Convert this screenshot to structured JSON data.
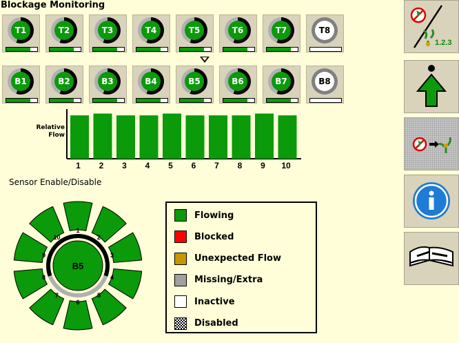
{
  "page_title": "Blockage Monitoring",
  "top_row": [
    {
      "label": "T1",
      "fill": 0.78
    },
    {
      "label": "T2",
      "fill": 0.78
    },
    {
      "label": "T3",
      "fill": 0.78
    },
    {
      "label": "T4",
      "fill": 0.78
    },
    {
      "label": "T5",
      "fill": 0.78
    },
    {
      "label": "T6",
      "fill": 0.78
    },
    {
      "label": "T7",
      "fill": 0.78
    },
    {
      "label": "T8",
      "fill": 0,
      "inactive": true
    }
  ],
  "bottom_row": [
    {
      "label": "B1",
      "fill": 0.78
    },
    {
      "label": "B2",
      "fill": 0.78
    },
    {
      "label": "B3",
      "fill": 0.78
    },
    {
      "label": "B4",
      "fill": 0.78
    },
    {
      "label": "B5",
      "fill": 0.78
    },
    {
      "label": "B6",
      "fill": 0.78
    },
    {
      "label": "B7",
      "fill": 0.78
    },
    {
      "label": "B8",
      "fill": 0,
      "inactive": true
    }
  ],
  "relative_flow_label": "Relative Flow",
  "chart_data": {
    "type": "bar",
    "ylabel": "Relative Flow",
    "categories": [
      "1",
      "2",
      "3",
      "4",
      "5",
      "6",
      "7",
      "8",
      "9",
      "10"
    ],
    "values": [
      0.96,
      1.0,
      0.96,
      0.96,
      1.0,
      0.96,
      0.96,
      0.96,
      1.0,
      0.96
    ],
    "ylim": [
      0,
      1.1
    ],
    "color": "#0a9a0a"
  },
  "sensor_enable_label": "Sensor Enable/Disable",
  "wheel": {
    "center_label": "B5",
    "sensor_numbers": [
      "1",
      "2",
      "3",
      "4",
      "5",
      "6",
      "7",
      "8",
      "9",
      "10"
    ]
  },
  "legend": [
    {
      "label": "Flowing",
      "color": "#0a9a0a"
    },
    {
      "label": "Blocked",
      "color": "#ff0000"
    },
    {
      "label": "Unexpected Flow",
      "color": "#c89600"
    },
    {
      "label": "Missing/Extra",
      "color": "#a0a0a0"
    },
    {
      "label": "Inactive",
      "color": "#ffffff"
    },
    {
      "label": "Disabled",
      "color": "checker"
    }
  ],
  "sidebar": {
    "buttons": [
      {
        "name": "seed-rate-button",
        "icon": "seed-rate-icon",
        "text": "1.2.3"
      },
      {
        "name": "navigate-up-button",
        "icon": "up-arrow-icon"
      },
      {
        "name": "blockage-display-button",
        "icon": "blockage-display-icon",
        "selected": true
      },
      {
        "name": "info-button",
        "icon": "info-icon"
      },
      {
        "name": "manual-button",
        "icon": "manual-icon"
      }
    ]
  }
}
